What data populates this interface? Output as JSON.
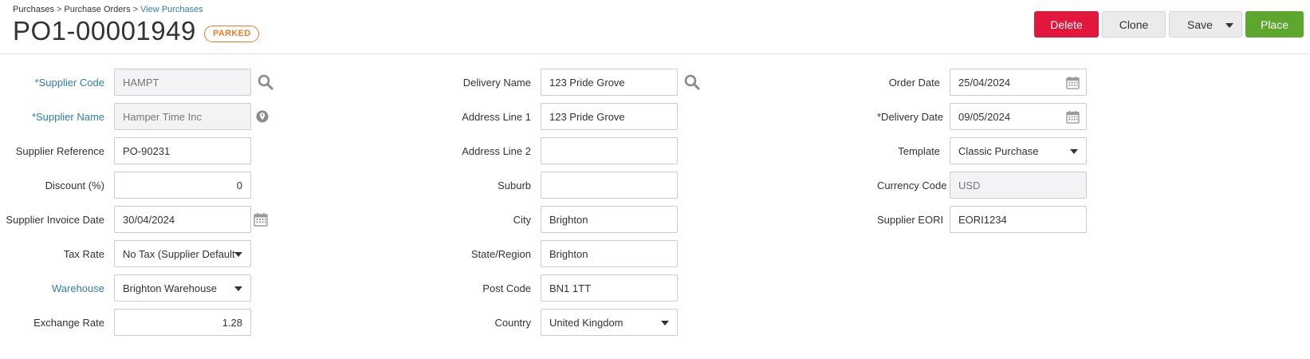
{
  "breadcrumb": {
    "items": [
      "Purchases",
      "Purchase Orders",
      "View Purchases"
    ],
    "separator": ">"
  },
  "header": {
    "title": "PO1-00001949",
    "status": "PARKED"
  },
  "actions": {
    "delete": "Delete",
    "clone": "Clone",
    "save": "Save",
    "place": "Place"
  },
  "supplier": {
    "code_label": "*Supplier Code",
    "code_value": "HAMPT",
    "name_label": "*Supplier Name",
    "name_value": "Hamper Time Inc",
    "reference_label": "Supplier Reference",
    "reference_value": "PO-90231",
    "discount_label": "Discount (%)",
    "discount_value": "0",
    "invoice_date_label": "Supplier Invoice Date",
    "invoice_date_value": "30/04/2024",
    "tax_rate_label": "Tax Rate",
    "tax_rate_value": "No Tax (Supplier Default",
    "warehouse_label": "Warehouse",
    "warehouse_value": "Brighton Warehouse",
    "exchange_rate_label": "Exchange Rate",
    "exchange_rate_value": "1.28"
  },
  "delivery": {
    "name_label": "Delivery Name",
    "name_value": "123 Pride Grove",
    "address1_label": "Address Line 1",
    "address1_value": "123 Pride Grove",
    "address2_label": "Address Line 2",
    "address2_value": "",
    "suburb_label": "Suburb",
    "suburb_value": "",
    "city_label": "City",
    "city_value": "Brighton",
    "state_label": "State/Region",
    "state_value": "Brighton",
    "postcode_label": "Post Code",
    "postcode_value": "BN1 1TT",
    "country_label": "Country",
    "country_value": "United Kingdom"
  },
  "order": {
    "order_date_label": "Order Date",
    "order_date_value": "25/04/2024",
    "delivery_date_label": "*Delivery Date",
    "delivery_date_value": "09/05/2024",
    "template_label": "Template",
    "template_value": "Classic Purchase",
    "currency_label": "Currency Code",
    "currency_value": "USD",
    "eori_label": "Supplier EORI",
    "eori_value": "EORI1234"
  },
  "colors": {
    "link": "#2d7fae",
    "delete": "#e3163d",
    "place": "#5da72e",
    "status": "#f07e26"
  },
  "icons": {
    "search": "search-icon",
    "location": "location-pin-icon",
    "calendar": "calendar-icon",
    "dropdown": "chevron-down-icon"
  }
}
